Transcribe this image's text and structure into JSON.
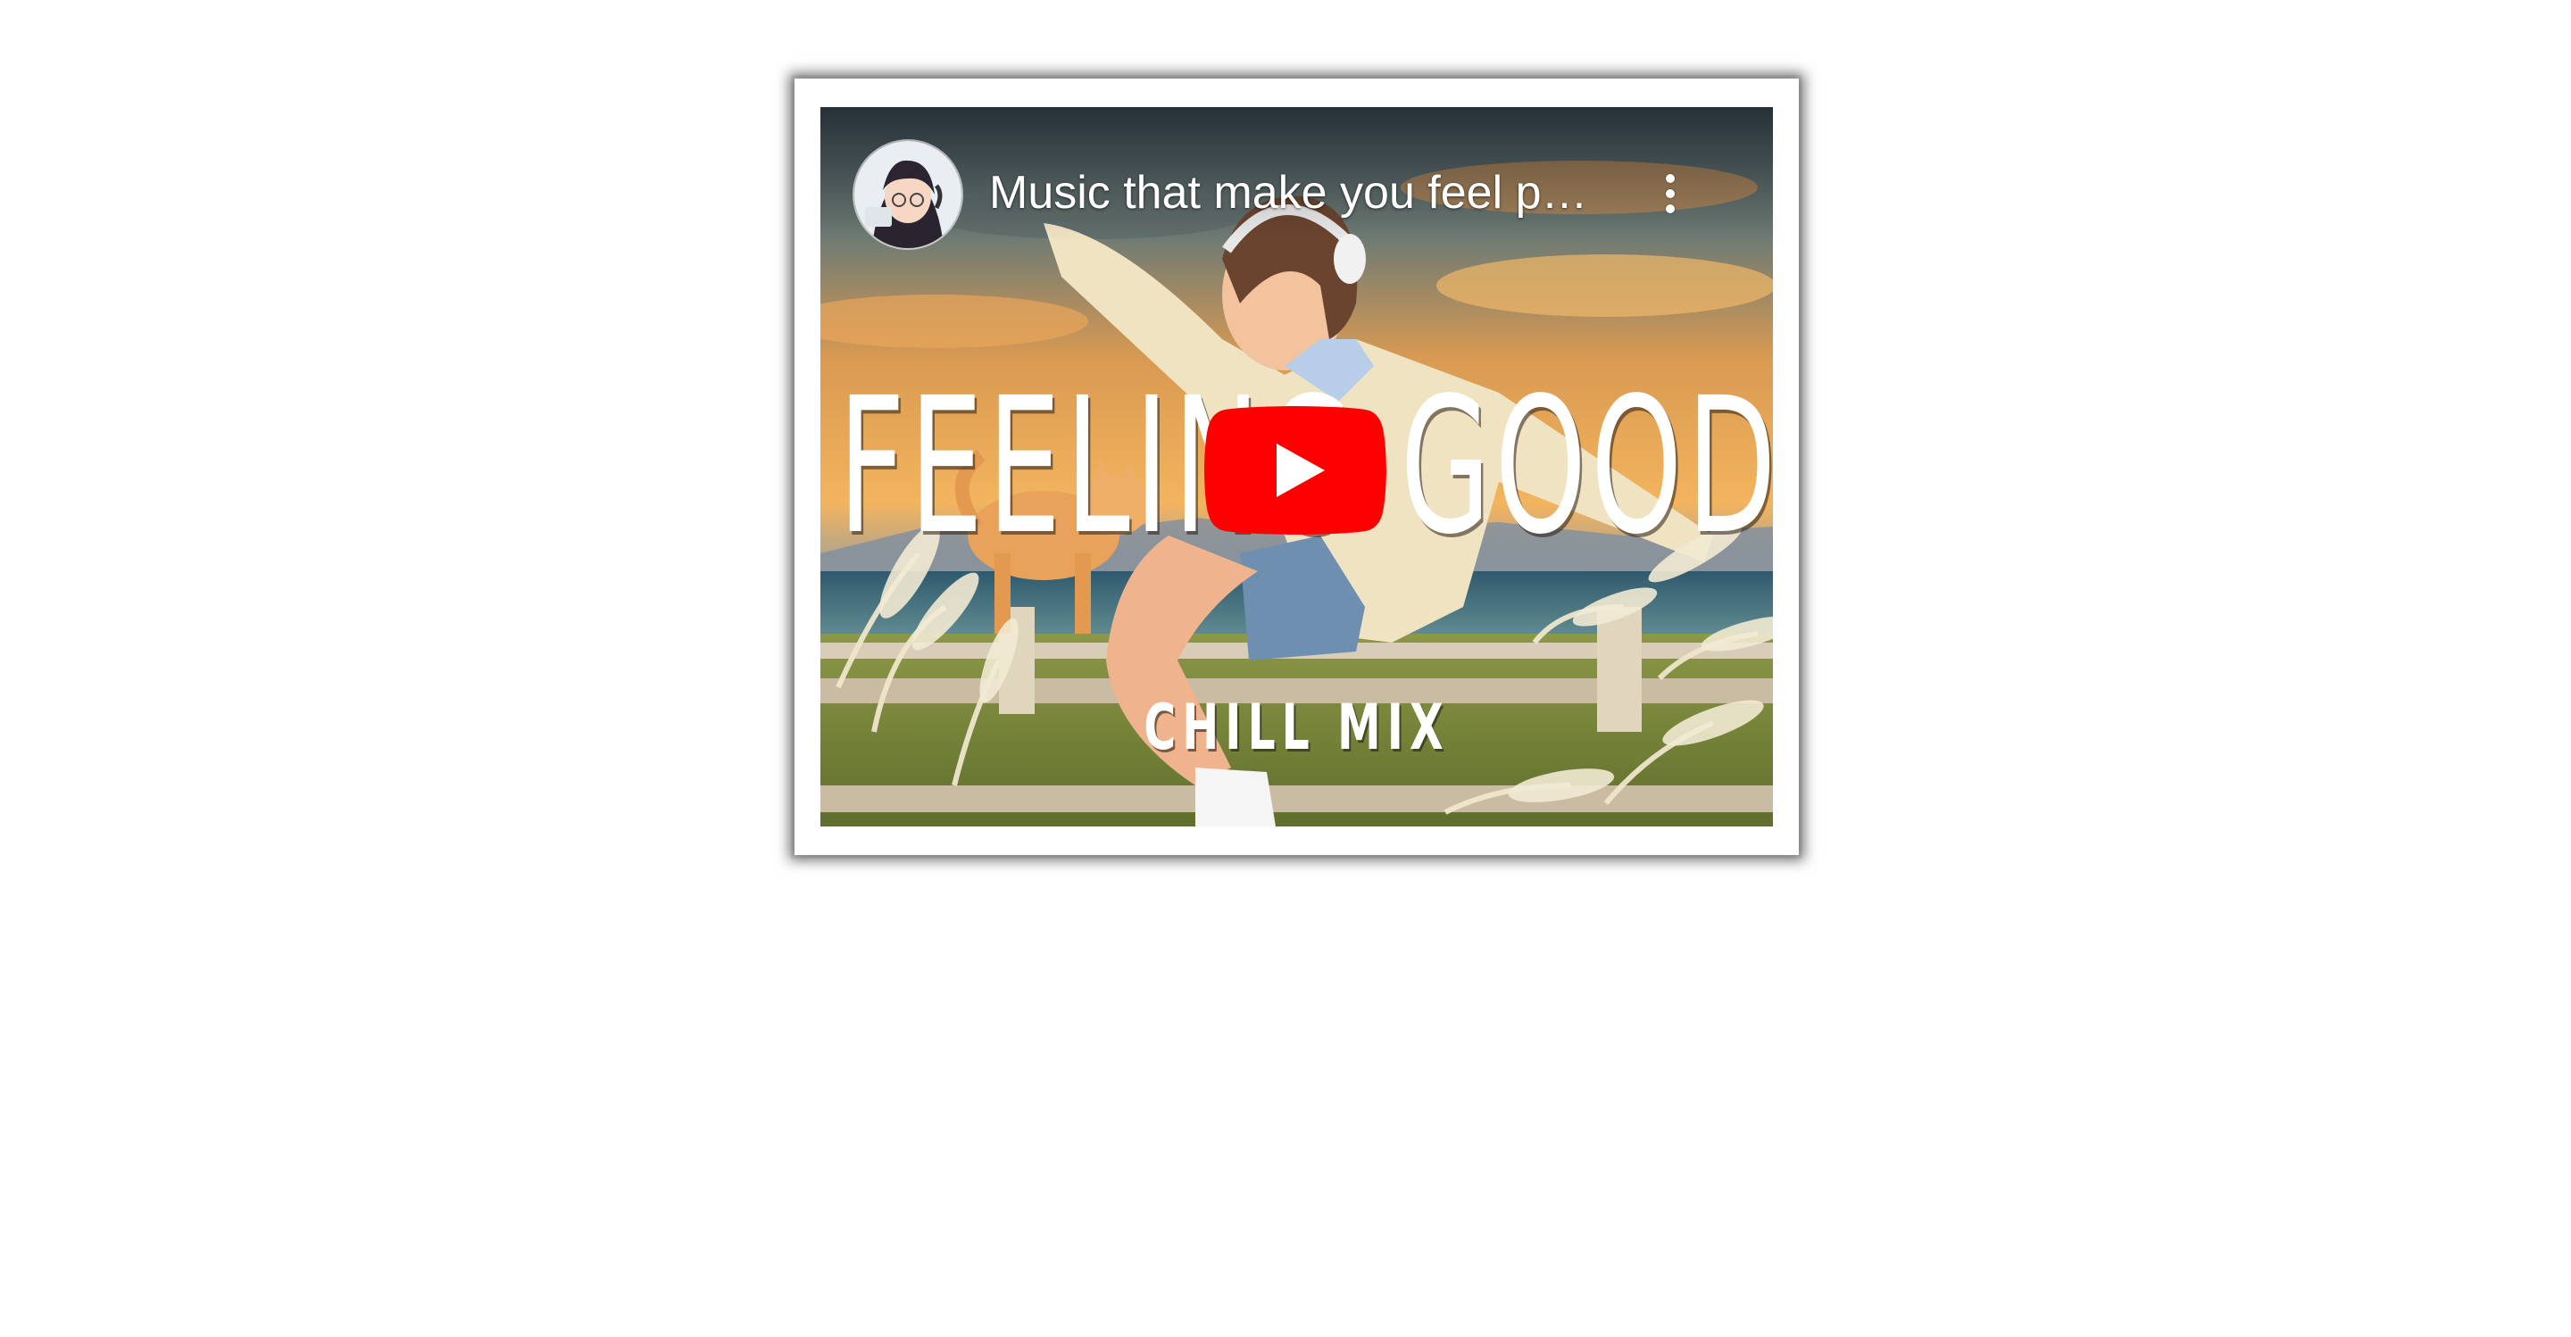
{
  "video": {
    "title": "Music that make you feel p…",
    "thumbnail_text": {
      "headline": "FEELING GOOD",
      "subline": "CHILL MIX"
    },
    "play_icon": "play-icon",
    "menu_icon": "more-vert-icon"
  },
  "colors": {
    "play_red": "#ff0000",
    "sky_top": "#3b4a52",
    "sky_orange": "#f2a64a",
    "grass": "#7b8a3a"
  }
}
